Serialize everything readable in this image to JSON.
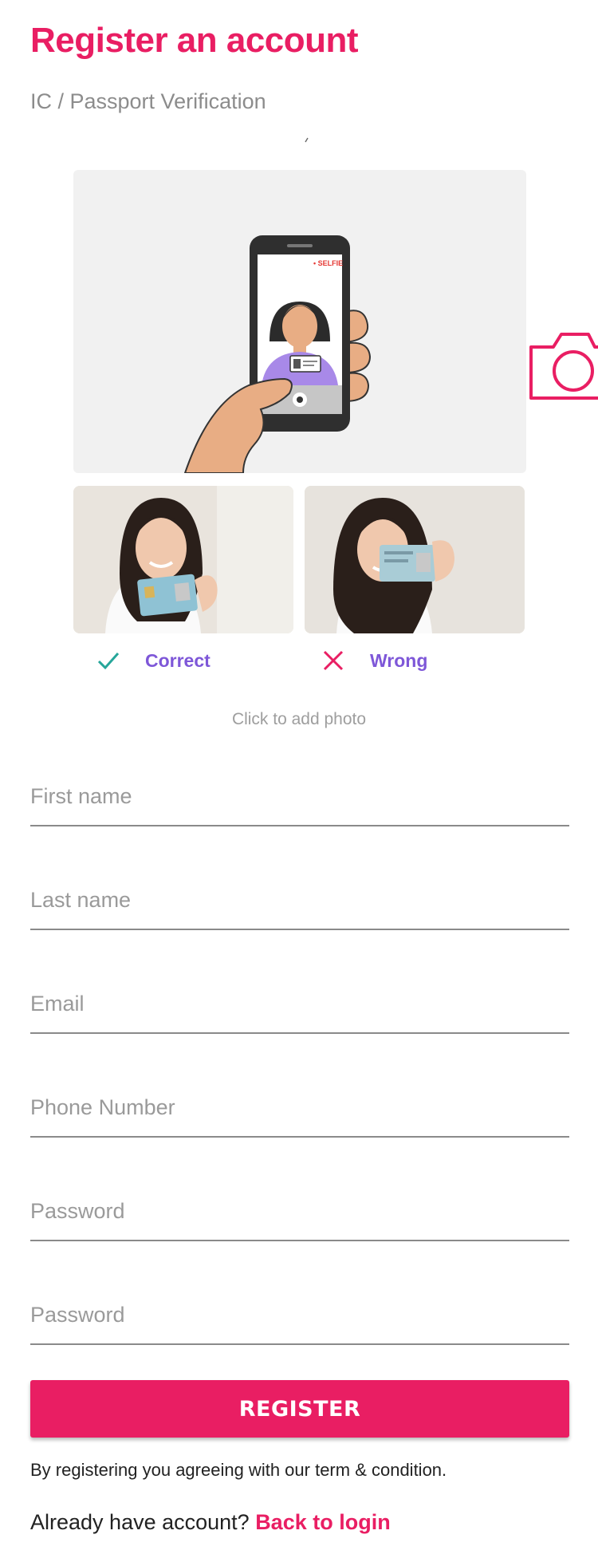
{
  "page": {
    "title": "Register an account",
    "subtitle": "IC / Passport Verification"
  },
  "colors": {
    "accent": "#e91e63",
    "verdict_label": "#7e57d8",
    "correct_check": "#26a69a",
    "wrong_cross": "#e91e63"
  },
  "upload": {
    "illustration_badge": "• SELFIE",
    "camera_icon": "camera-icon",
    "hint": "Click to add photo"
  },
  "examples": [
    {
      "label": "Correct",
      "icon": "check-icon"
    },
    {
      "label": "Wrong",
      "icon": "cross-icon"
    }
  ],
  "form": {
    "first_name": {
      "placeholder": "First name",
      "value": ""
    },
    "last_name": {
      "placeholder": "Last name",
      "value": ""
    },
    "email": {
      "placeholder": "Email",
      "value": ""
    },
    "phone": {
      "placeholder": "Phone Number",
      "value": ""
    },
    "password": {
      "placeholder": "Password",
      "value": ""
    },
    "password_confirm": {
      "placeholder": "Password",
      "value": ""
    }
  },
  "register_button": "REGISTER",
  "terms": "By registering you agreeing with our term & condition.",
  "login": {
    "prompt": "Already have account? ",
    "link": "Back to login"
  }
}
